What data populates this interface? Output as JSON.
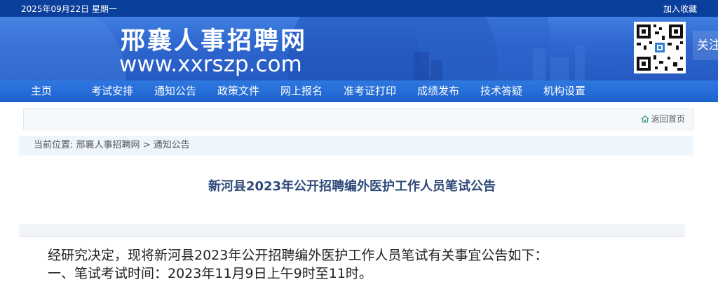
{
  "topbar": {
    "date": "2025年09月22日 星期一",
    "favorite": "加入收藏"
  },
  "header": {
    "site_name": "邢襄人事招聘网",
    "site_url": "www.xxrszp.com",
    "follow_label": "关注"
  },
  "nav": {
    "items": [
      "主页",
      "考试安排",
      "通知公告",
      "政策文件",
      "网上报名",
      "准考证打印",
      "成绩发布",
      "技术答疑",
      "机构设置"
    ]
  },
  "back_home": "返回首页",
  "breadcrumb": {
    "prefix": "当前位置:",
    "home": "邢襄人事招聘网",
    "sep": ">",
    "current": "通知公告"
  },
  "article": {
    "title": "新河县2023年公开招聘编外医护工作人员笔试公告",
    "paragraphs": [
      "经研究决定，现将新河县2023年公开招聘编外医护工作人员笔试有关事宜公告如下：",
      "一、笔试考试时间：2023年11月9日上午9时至11时。"
    ]
  },
  "colors": {
    "top_bar": "#0b3f9c",
    "nav_bar": "#2368d3",
    "title": "#2f4a7a"
  },
  "icons": [
    "qr-code",
    "home-icon"
  ]
}
